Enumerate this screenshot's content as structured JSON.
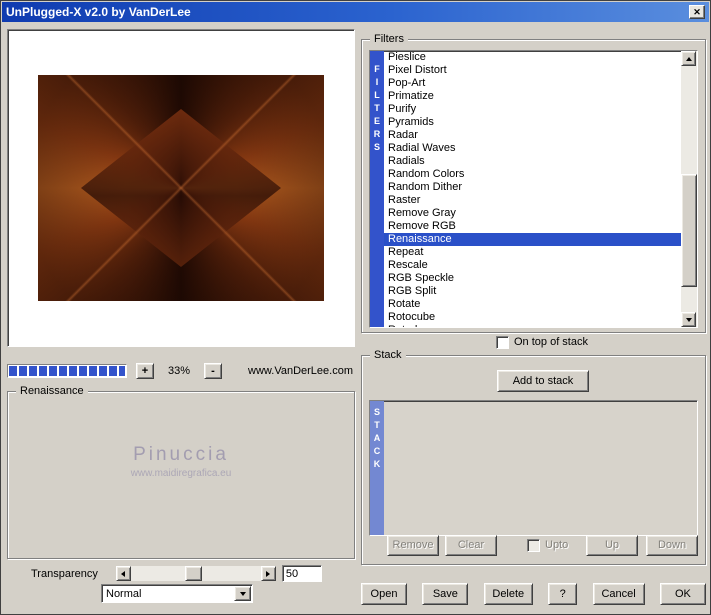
{
  "window": {
    "title": "UnPlugged-X v2.0 by VanDerLee",
    "close_glyph": "✕"
  },
  "preview": {
    "zoom_in": "+",
    "zoom_out": "-",
    "zoom_value": "33%",
    "website": "www.VanDerLee.com"
  },
  "renaissance_panel": {
    "title": "Renaissance",
    "watermark_name": "Pinuccia",
    "watermark_url": "www.maidiregrafica.eu",
    "transparency_label": "Transparency",
    "transparency_value": "50",
    "blend_mode": "Normal"
  },
  "filters": {
    "title": "Filters",
    "strip_letters": [
      "F",
      "I",
      "L",
      "T",
      "E",
      "R",
      "S"
    ],
    "items": [
      "Pieslice",
      "Pixel Distort",
      "Pop-Art",
      "Primatize",
      "Purify",
      "Pyramids",
      "Radar",
      "Radial Waves",
      "Radials",
      "Random Colors",
      "Random Dither",
      "Raster",
      "Remove Gray",
      "Remove RGB",
      "Renaissance",
      "Repeat",
      "Rescale",
      "RGB Speckle",
      "RGB Split",
      "Rotate",
      "Rotocube",
      "Rotodraw"
    ],
    "selected": "Renaissance",
    "on_top_label": "On top of stack"
  },
  "stack": {
    "title": "Stack",
    "strip_letters": [
      "S",
      "T",
      "A",
      "C",
      "K"
    ],
    "add_button": "Add to stack",
    "remove_button": "Remove",
    "clear_button": "Clear",
    "upto_label": "Upto",
    "up_button": "Up",
    "down_button": "Down"
  },
  "actions": {
    "open": "Open",
    "save": "Save",
    "delete": "Delete",
    "help": "?",
    "cancel": "Cancel",
    "ok": "OK"
  },
  "colors": {
    "dialog_bg": "#d4d0c8",
    "title_gradient_start": "#0f3bb0",
    "title_gradient_end": "#5a8ede",
    "accent_blue": "#3353cb",
    "stack_strip_blue": "#7388d2",
    "selection_blue": "#2a50c8",
    "preview_rust": "#b05a1e"
  }
}
